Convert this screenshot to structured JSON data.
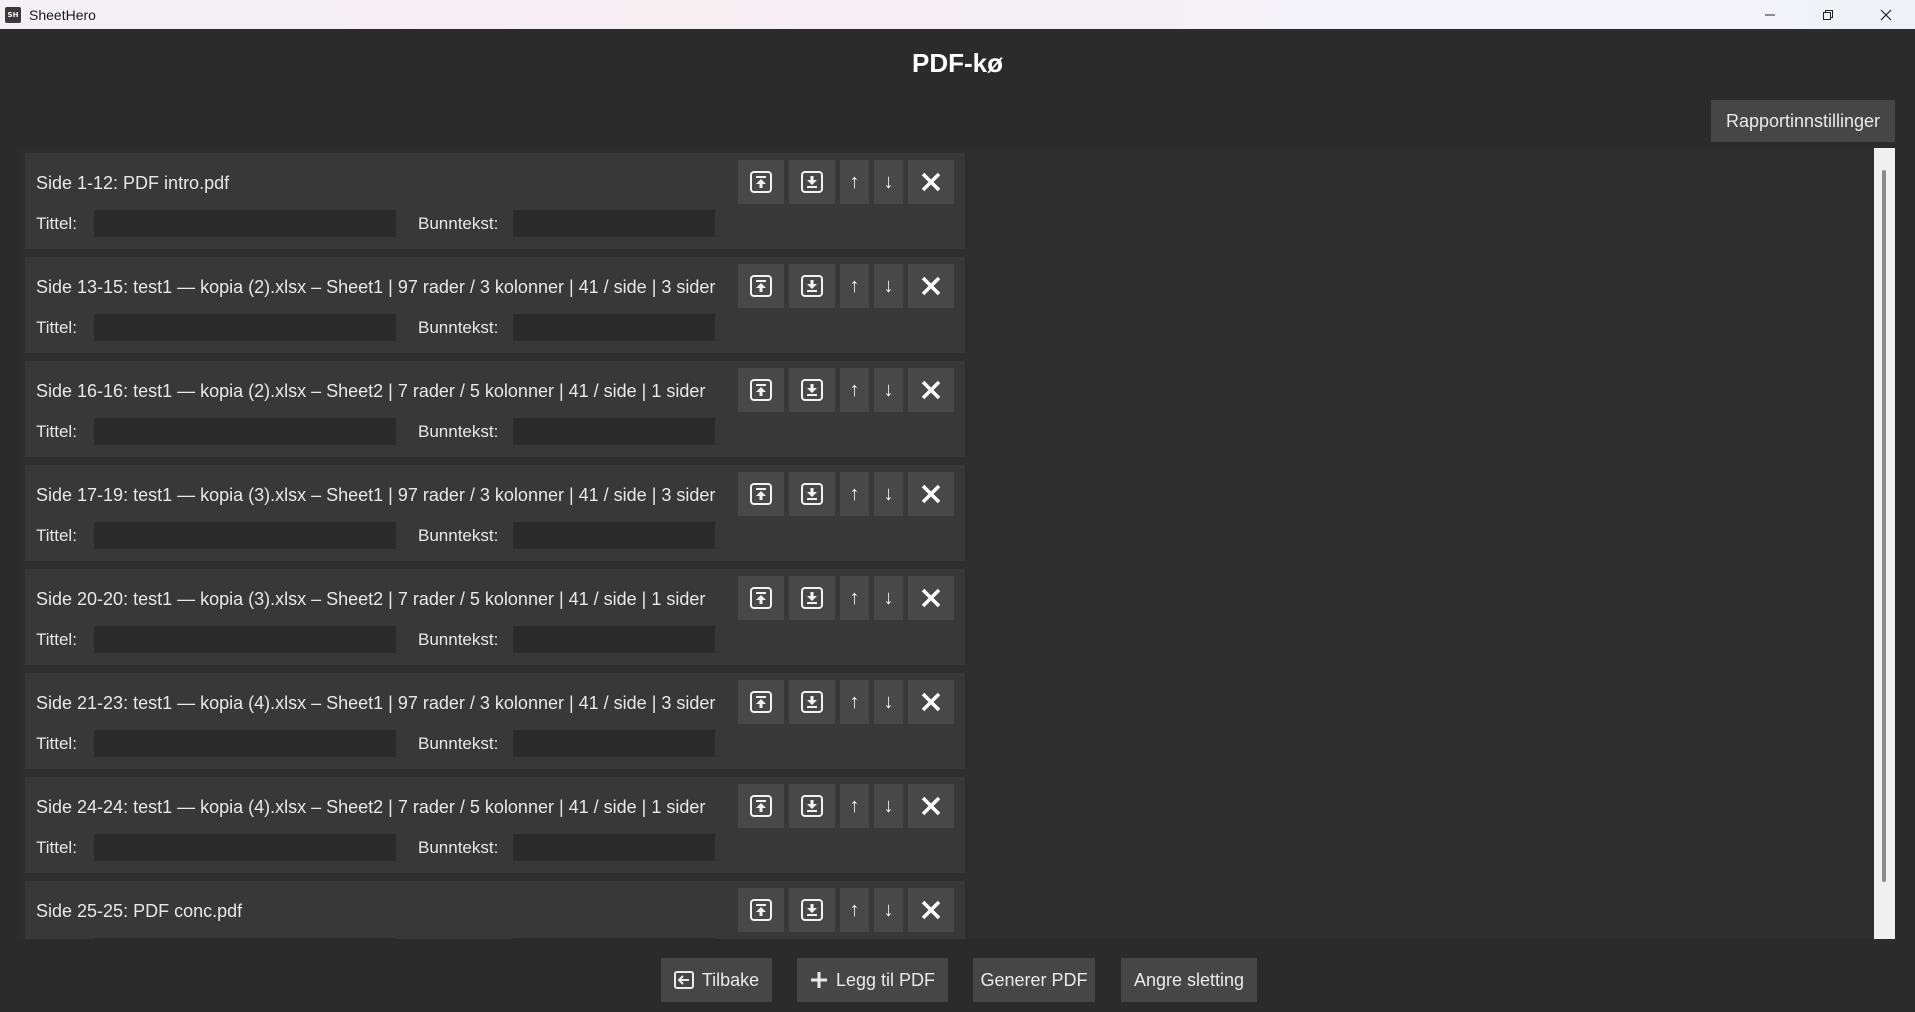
{
  "window": {
    "app_icon_text": "SH",
    "app_title": "SheetHero"
  },
  "page": {
    "title": "PDF-kø",
    "report_settings_label": "Rapportinnstillinger"
  },
  "field_labels": {
    "title": "Tittel:",
    "footer": "Bunntekst:"
  },
  "controls": {
    "up_symbol": "↑",
    "down_symbol": "↓"
  },
  "items": [
    {
      "label": "Side 1-12: PDF intro.pdf",
      "title_value": "",
      "footer_value": ""
    },
    {
      "label": "Side 13-15: test1 — kopia (2).xlsx – Sheet1 | 97 rader / 3 kolonner | 41 / side | 3 sider",
      "title_value": "",
      "footer_value": ""
    },
    {
      "label": "Side 16-16: test1 — kopia (2).xlsx – Sheet2 | 7 rader / 5 kolonner | 41 / side | 1 sider",
      "title_value": "",
      "footer_value": ""
    },
    {
      "label": "Side 17-19: test1 — kopia (3).xlsx – Sheet1 | 97 rader / 3 kolonner | 41 / side | 3 sider",
      "title_value": "",
      "footer_value": ""
    },
    {
      "label": "Side 20-20: test1 — kopia (3).xlsx – Sheet2 | 7 rader / 5 kolonner | 41 / side | 1 sider",
      "title_value": "",
      "footer_value": ""
    },
    {
      "label": "Side 21-23: test1 — kopia (4).xlsx – Sheet1 | 97 rader / 3 kolonner | 41 / side | 3 sider",
      "title_value": "",
      "footer_value": ""
    },
    {
      "label": "Side 24-24: test1 — kopia (4).xlsx – Sheet2 | 7 rader / 5 kolonner | 41 / side | 1 sider",
      "title_value": "",
      "footer_value": ""
    },
    {
      "label": "Side 25-25: PDF conc.pdf",
      "title_value": "",
      "footer_value": ""
    }
  ],
  "bottom_buttons": {
    "back_label": "Tilbake",
    "add_pdf_label": "Legg til PDF",
    "generate_label": "Generer PDF",
    "undo_delete_label": "Angre sletting"
  }
}
